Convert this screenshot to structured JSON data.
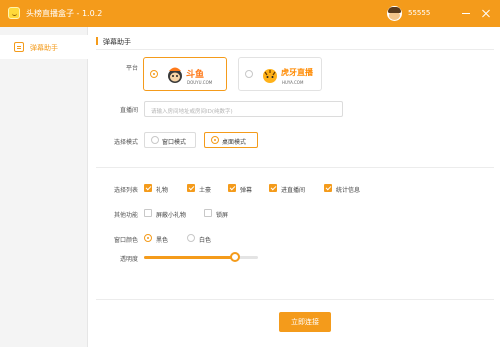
{
  "window": {
    "title": "头榜直播盒子 - 1.0.2",
    "user_name": "55555",
    "brand_color": "#f49b1b"
  },
  "sidebar": {
    "items": [
      {
        "label": "弹幕助手",
        "icon": "danmaku-icon",
        "selected": true
      }
    ]
  },
  "main": {
    "section_title": "弹幕助手",
    "platform": {
      "label": "平台",
      "options": [
        {
          "name": "douyu",
          "logo_text": "斗鱼",
          "logo_sub": "DOUYU.COM",
          "selected": true
        },
        {
          "name": "huya",
          "logo_text": "虎牙直播",
          "logo_sub": "HUYA.COM",
          "selected": false
        }
      ]
    },
    "room": {
      "label": "直播间",
      "placeholder": "请输入房间地址或房间ID(纯数字)",
      "value": ""
    },
    "mode": {
      "label": "选择模式",
      "options": [
        {
          "label": "窗口模式",
          "selected": false
        },
        {
          "label": "桌面模式",
          "selected": true
        }
      ]
    },
    "list": {
      "label": "选择列表",
      "options": [
        {
          "label": "礼物",
          "checked": true
        },
        {
          "label": "土豪",
          "checked": true
        },
        {
          "label": "弹幕",
          "checked": true
        },
        {
          "label": "进直播间",
          "checked": true
        },
        {
          "label": "统计信息",
          "checked": true
        }
      ]
    },
    "other": {
      "label": "其他功能",
      "options": [
        {
          "label": "屏蔽小礼物",
          "checked": false
        },
        {
          "label": "锁屏",
          "checked": false
        }
      ]
    },
    "color": {
      "label": "窗口颜色",
      "options": [
        {
          "label": "黑色",
          "selected": true
        },
        {
          "label": "白色",
          "selected": false
        }
      ]
    },
    "opacity": {
      "label": "透明度",
      "value": 0.8
    },
    "connect_label": "立即连接"
  }
}
